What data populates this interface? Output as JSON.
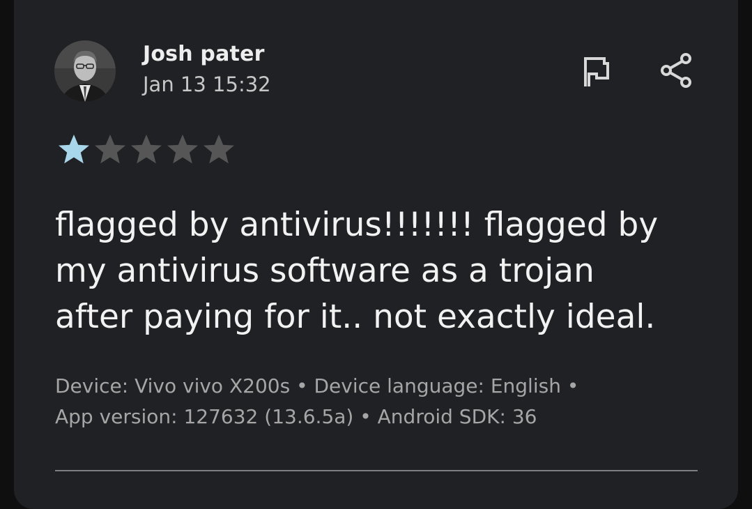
{
  "review": {
    "author": "Josh pater",
    "date": "Jan 13 15:32",
    "rating": 1,
    "max_rating": 5,
    "text_lines": [
      "flagged by antivirus!!!!!!! flagged by",
      "my antivirus software as a trojan",
      "after paying for it.. not exactly ideal."
    ],
    "meta_lines": [
      "Device: Vivo vivo X200s • Device language: English •",
      "App version: 127632 (13.6.5a) • Android SDK: 36"
    ]
  },
  "icons": {
    "flag": "flag-icon",
    "share": "share-icon",
    "avatar": "avatar"
  },
  "colors": {
    "background": "#0f0f10",
    "card": "#202125",
    "star_filled": "#a8d6ea",
    "star_empty": "#565656",
    "text_primary": "#f2f2f2",
    "text_secondary": "#a6a6a6"
  }
}
